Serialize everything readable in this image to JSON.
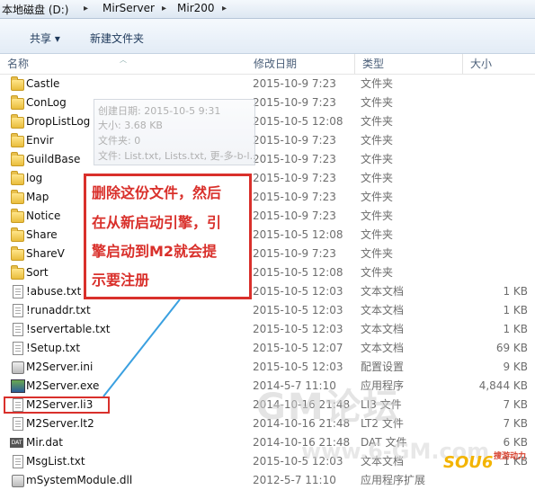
{
  "breadcrumb": [
    "本地磁盘 (D:)",
    "MirServer",
    "Mir200"
  ],
  "toolbar": {
    "share": "共享 ▾",
    "new_folder": "新建文件夹"
  },
  "columns": {
    "name": "名称",
    "date": "修改日期",
    "type": "类型",
    "size": "大小"
  },
  "rows": [
    {
      "name": "Castle",
      "date": "2015-10-9 7:23",
      "type": "文件夹",
      "size": "",
      "icon": "folder-icon"
    },
    {
      "name": "ConLog",
      "date": "2015-10-9 7:23",
      "type": "文件夹",
      "size": "",
      "icon": "folder-icon"
    },
    {
      "name": "DropListLog",
      "date": "2015-10-5 12:08",
      "type": "文件夹",
      "size": "",
      "icon": "folder-icon"
    },
    {
      "name": "Envir",
      "date": "2015-10-9 7:23",
      "type": "文件夹",
      "size": "",
      "icon": "folder-icon"
    },
    {
      "name": "GuildBase",
      "date": "2015-10-9 7:23",
      "type": "文件夹",
      "size": "",
      "icon": "folder-icon"
    },
    {
      "name": "log",
      "date": "2015-10-9 7:23",
      "type": "文件夹",
      "size": "",
      "icon": "folder-icon"
    },
    {
      "name": "Map",
      "date": "2015-10-9 7:23",
      "type": "文件夹",
      "size": "",
      "icon": "folder-icon"
    },
    {
      "name": "Notice",
      "date": "2015-10-9 7:23",
      "type": "文件夹",
      "size": "",
      "icon": "folder-icon"
    },
    {
      "name": "Share",
      "date": "2015-10-5 12:08",
      "type": "文件夹",
      "size": "",
      "icon": "folder-icon"
    },
    {
      "name": "ShareV",
      "date": "2015-10-9 7:23",
      "type": "文件夹",
      "size": "",
      "icon": "folder-icon"
    },
    {
      "name": "Sort",
      "date": "2015-10-5 12:08",
      "type": "文件夹",
      "size": "",
      "icon": "folder-icon"
    },
    {
      "name": "!abuse.txt",
      "date": "2015-10-5 12:03",
      "type": "文本文档",
      "size": "1 KB",
      "icon": "text-file-icon"
    },
    {
      "name": "!runaddr.txt",
      "date": "2015-10-5 12:03",
      "type": "文本文档",
      "size": "1 KB",
      "icon": "text-file-icon"
    },
    {
      "name": "!servertable.txt",
      "date": "2015-10-5 12:03",
      "type": "文本文档",
      "size": "1 KB",
      "icon": "text-file-icon"
    },
    {
      "name": "!Setup.txt",
      "date": "2015-10-5 12:07",
      "type": "文本文档",
      "size": "69 KB",
      "icon": "text-file-icon"
    },
    {
      "name": "M2Server.ini",
      "date": "2015-10-5 12:03",
      "type": "配置设置",
      "size": "9 KB",
      "icon": "config-file-icon"
    },
    {
      "name": "M2Server.exe",
      "date": "2014-5-7 11:10",
      "type": "应用程序",
      "size": "4,844 KB",
      "icon": "exe-file-icon"
    },
    {
      "name": "M2Server.li3",
      "date": "2014-10-16 21:48",
      "type": "LI3 文件",
      "size": "7 KB",
      "icon": "blank-file-icon"
    },
    {
      "name": "M2Server.lt2",
      "date": "2014-10-16 21:48",
      "type": "LT2 文件",
      "size": "7 KB",
      "icon": "blank-file-icon"
    },
    {
      "name": "Mir.dat",
      "date": "2014-10-16 21:48",
      "type": "DAT 文件",
      "size": "6 KB",
      "icon": "dat-file-icon"
    },
    {
      "name": "MsgList.txt",
      "date": "2015-10-5 12:03",
      "type": "文本文档",
      "size": "1 KB",
      "icon": "text-file-icon"
    },
    {
      "name": "mSystemModule.dll",
      "date": "2012-5-7 11:10",
      "type": "应用程序扩展",
      "size": "",
      "icon": "dll-file-icon"
    }
  ],
  "tooltip": {
    "created": "创建日期: 2015-10-5 9:31",
    "size": "大小: 3.68 KB",
    "folders": "文件夹: 0",
    "files": "文件: List.txt, Lists.txt, 更-多-b-l..."
  },
  "callout": {
    "line1": "删除这份文件，然后",
    "line2": "在从新启动引擎，引",
    "line3": "擎启动到M2就会提",
    "line4": "示要注册"
  },
  "watermark": {
    "main": "GM论坛",
    "sub": "www.6-GM.com"
  },
  "logo": {
    "text": "SOU6",
    "tag": "搜游动力"
  },
  "colors": {
    "callout": "#d9302b",
    "folder": "#e9bd3c"
  }
}
